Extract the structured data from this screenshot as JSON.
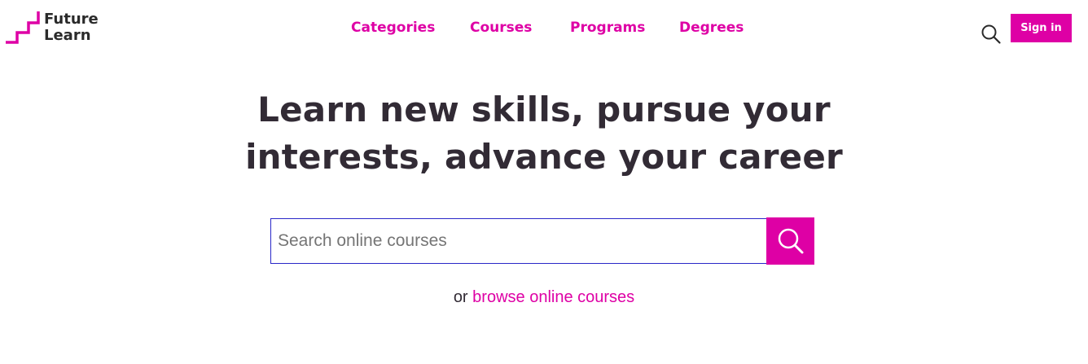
{
  "brand": {
    "name_line1": "Future",
    "name_line2": "Learn",
    "logo_icon": "staircase-logo-icon",
    "accent_color": "#de00a5",
    "text_color": "#322b35"
  },
  "nav": {
    "items": [
      {
        "label": "Categories"
      },
      {
        "label": "Courses"
      },
      {
        "label": "Programs"
      },
      {
        "label": "Degrees"
      }
    ]
  },
  "header": {
    "search_icon": "search-icon",
    "signin_label": "Sign in"
  },
  "hero": {
    "title_line1": "Learn new skills, pursue your",
    "title_line2": "interests, advance your career"
  },
  "search": {
    "placeholder": "Search online courses",
    "value": "",
    "button_icon": "search-icon"
  },
  "browse": {
    "prefix": "or",
    "link_label": "browse online courses"
  }
}
